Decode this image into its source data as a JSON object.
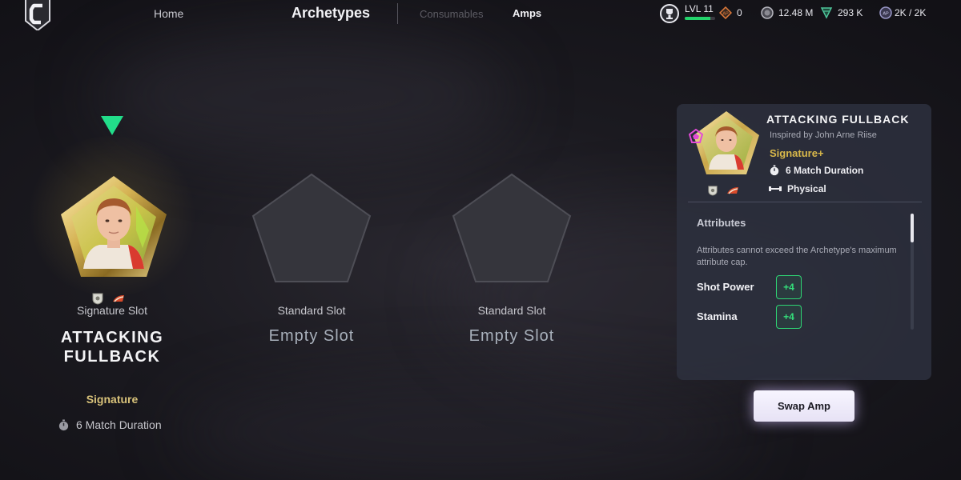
{
  "topbar": {
    "home": "Home",
    "title": "Archetypes",
    "consumables": "Consumables",
    "amps": "Amps",
    "level_label": "LVL 11",
    "level_progress": 0.85,
    "tokens": "0",
    "coins": "12.48 M",
    "points": "293 K",
    "capacity": "2K / 2K"
  },
  "slots": [
    {
      "label": "Signature Slot",
      "name": "ATTACKING FULLBACK",
      "rarity": "Signature",
      "duration": "6 Match Duration"
    },
    {
      "label": "Standard Slot",
      "name": "Empty Slot"
    },
    {
      "label": "Standard Slot",
      "name": "Empty Slot"
    }
  ],
  "detail": {
    "title": "ATTACKING FULLBACK",
    "inspired": "Inspired by John Arne Riise",
    "rarity": "Signature+",
    "duration": "6 Match Duration",
    "category": "Physical",
    "attributes_heading": "Attributes",
    "attributes_note": "Attributes cannot exceed the Archetype's maximum attribute cap.",
    "attributes": [
      {
        "name": "Shot Power",
        "bonus": "+4"
      },
      {
        "name": "Stamina",
        "bonus": "+4"
      }
    ]
  },
  "actions": {
    "swap": "Swap Amp"
  },
  "colors": {
    "accent_green": "#2ed574",
    "gold": "#d9b84a",
    "panel": "#2c303e"
  }
}
